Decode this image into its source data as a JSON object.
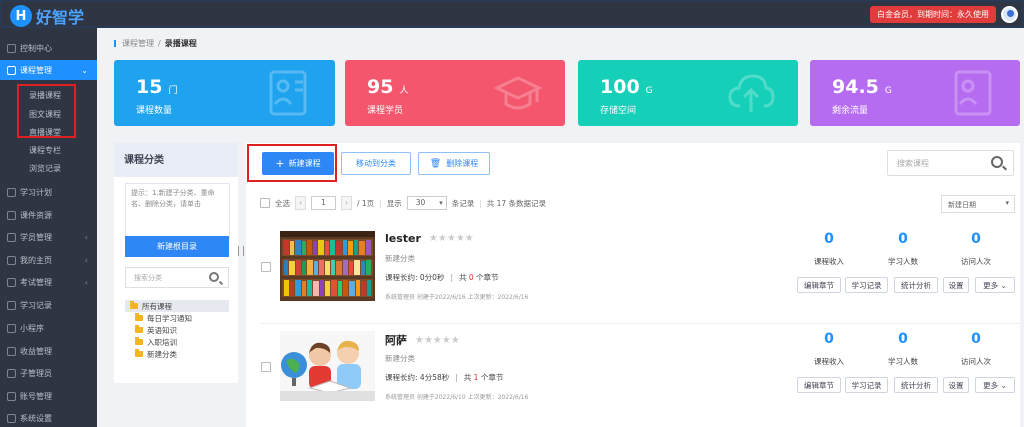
{
  "app": {
    "logo_letter": "H",
    "logo_text": "好智学",
    "member_badge": "白金会员，到期时间：永久使用"
  },
  "sidebar": {
    "items": [
      {
        "label": "控制中心",
        "icon": "home-icon"
      },
      {
        "label": "课程管理",
        "icon": "book-icon",
        "chevron": "⌄"
      },
      {
        "label": "学习计划",
        "icon": "eye-icon"
      },
      {
        "label": "课件资源",
        "icon": "file-icon"
      },
      {
        "label": "学员管理",
        "icon": "students-icon",
        "chevron": "‹"
      },
      {
        "label": "我的主页",
        "icon": "page-icon",
        "chevron": "‹"
      },
      {
        "label": "考试管理",
        "icon": "exam-icon",
        "chevron": "‹"
      },
      {
        "label": "学习记录",
        "icon": "record-icon"
      },
      {
        "label": "小程序",
        "icon": "miniapp-icon"
      },
      {
        "label": "收益管理",
        "icon": "wallet-icon"
      },
      {
        "label": "子管理员",
        "icon": "admin-icon"
      },
      {
        "label": "账号管理",
        "icon": "dollar-icon"
      },
      {
        "label": "系统设置",
        "icon": "gear-icon"
      }
    ],
    "sub_items": [
      "录播课程",
      "图文课程",
      "直播课堂",
      "课程专栏",
      "浏览记录"
    ]
  },
  "breadcrumb": {
    "parent": "课程管理",
    "separator": "/",
    "current": "录播课程"
  },
  "stats": [
    {
      "value": "15",
      "unit": "门",
      "label": "课程数量",
      "color": "#1fa3ef"
    },
    {
      "value": "95",
      "unit": "人",
      "label": "课程学员",
      "color": "#f4566e"
    },
    {
      "value": "100",
      "unit": "G",
      "label": "存储空间",
      "color": "#16cfb8"
    },
    {
      "value": "94.5",
      "unit": "G",
      "label": "剩余流量",
      "color": "#b66cf0"
    }
  ],
  "category": {
    "title": "课程分类",
    "tip": "提示：1.新建子分类、重命名、删除分类，请单击",
    "new_root": "新建根目录",
    "search_placeholder": "搜索分类",
    "tree": [
      "所有课程",
      "每日学习通知",
      "英语知识",
      "入职培训",
      "新建分类"
    ]
  },
  "toolbar": {
    "new_course": "新建课程",
    "move": "移动到分类",
    "delete": "删除课程",
    "search_placeholder": "搜索课程"
  },
  "pager": {
    "select_all": "全选",
    "page": "1",
    "total_pages": "/ 1页",
    "show": "显示",
    "per_page": "30",
    "records": "条记录",
    "total": "共 17 条数据记录",
    "sort": "新建日期"
  },
  "courses": [
    {
      "title": "lester",
      "category": "新建分类",
      "duration_label": "课程长约: 0分0秒",
      "chapters_prefix": "共",
      "chapters": "0",
      "chapters_suffix": "个章节",
      "footer": "系统管理员 创建于2022/6/16 上次更新：2022/6/16",
      "income": "0",
      "students": "0",
      "visits": "0"
    },
    {
      "title": "阿萨",
      "category": "新建分类",
      "duration_label": "课程长约: 4分58秒",
      "chapters_prefix": "共",
      "chapters": "1",
      "chapters_suffix": "个章节",
      "footer": "系统管理员 创建于2022/6/10 上次更新：2022/6/16",
      "income": "0",
      "students": "0",
      "visits": "0"
    }
  ],
  "metric_labels": {
    "income": "课程收入",
    "students": "学习人数",
    "visits": "访问人次"
  },
  "actions": {
    "edit": "编辑章节",
    "records": "学习记录",
    "stats": "统计分析",
    "settings": "设置",
    "more": "更多 ⌄"
  }
}
